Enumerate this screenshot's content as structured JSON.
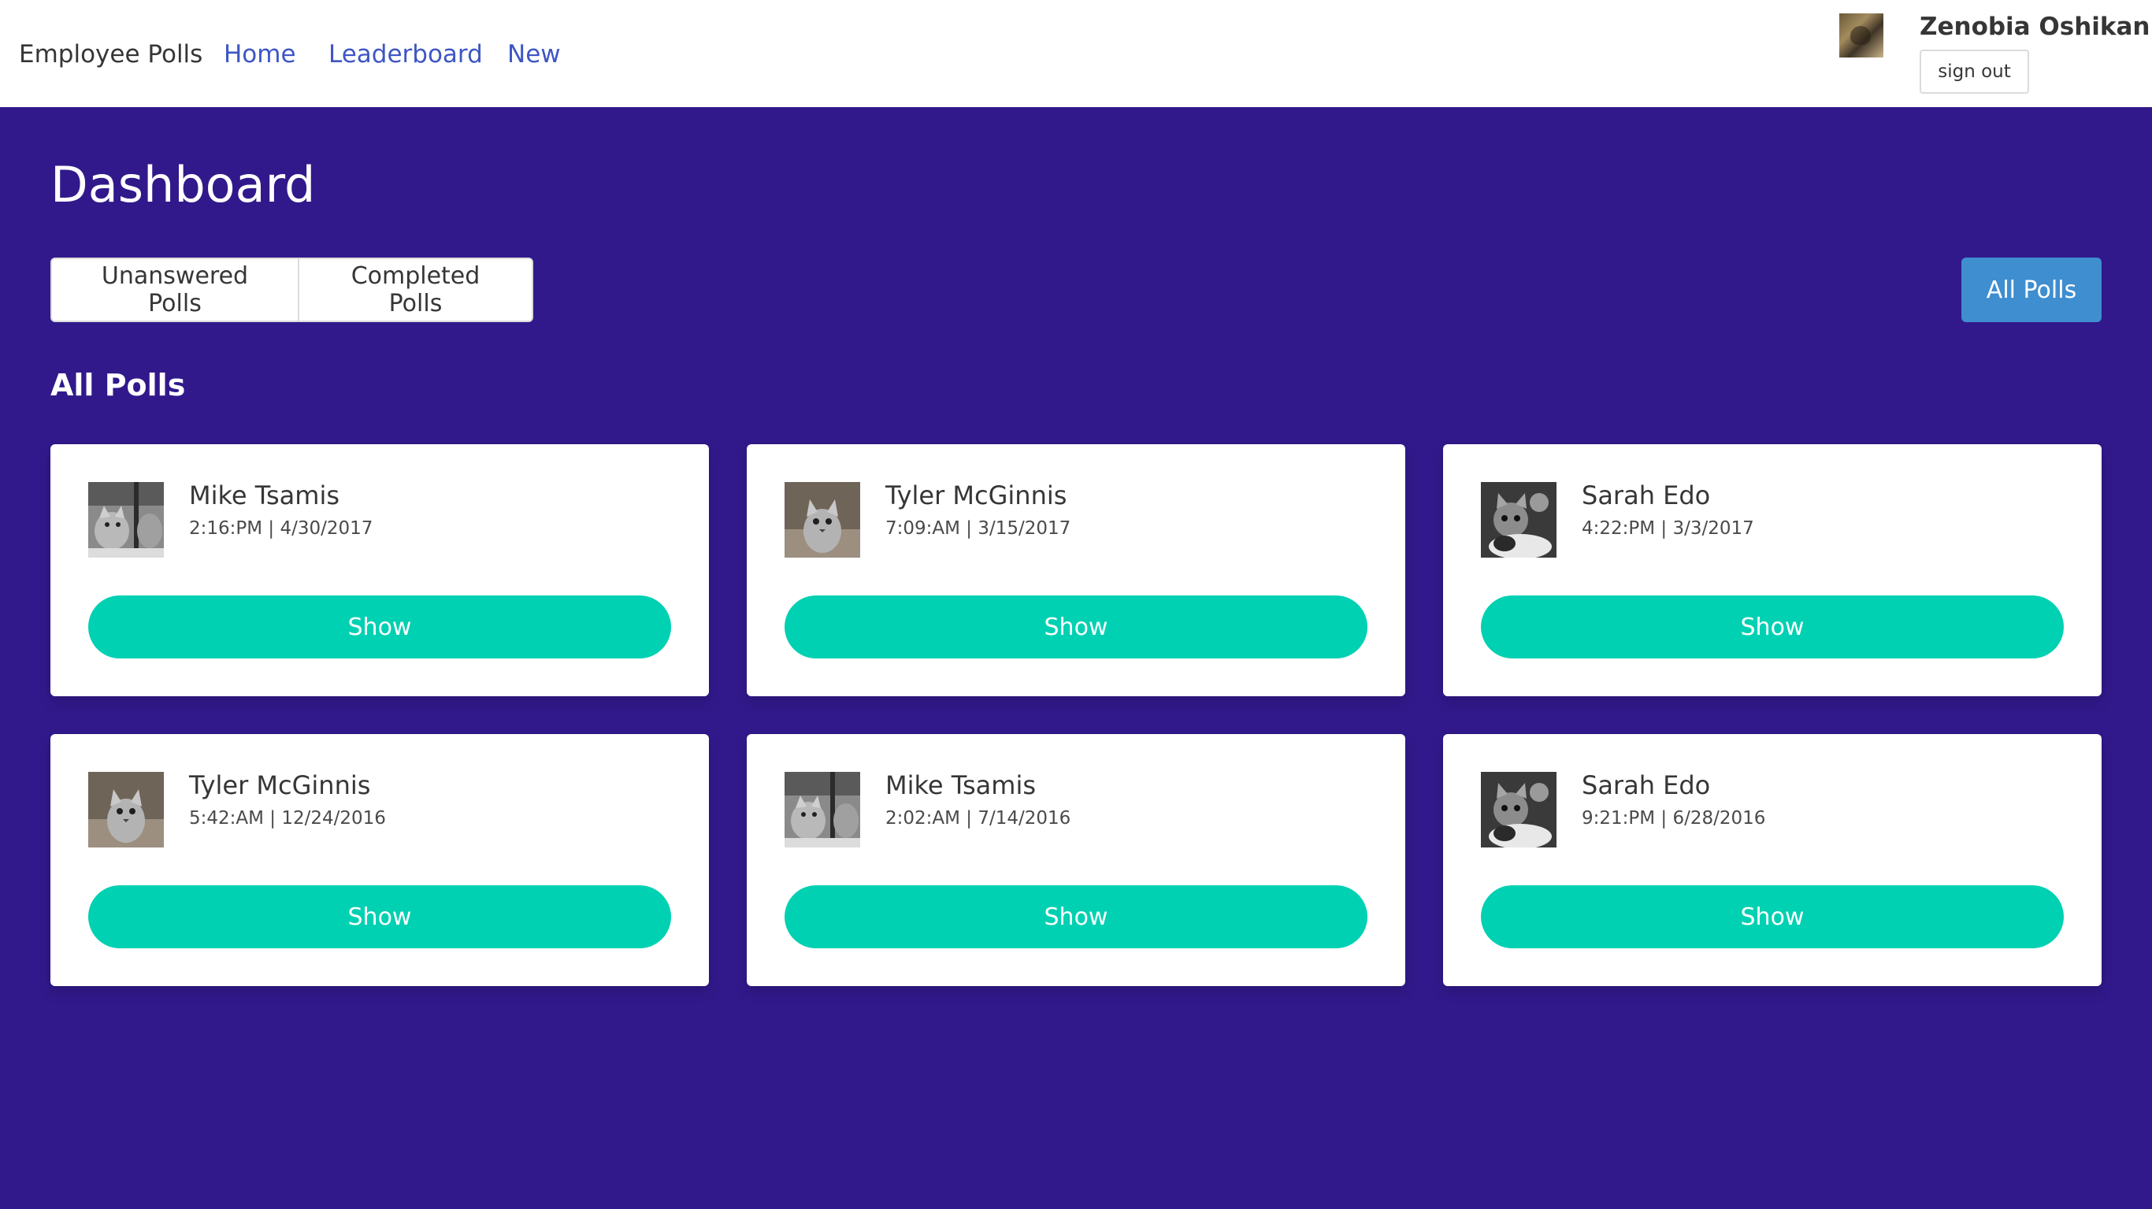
{
  "navbar": {
    "brand": "Employee Polls",
    "links": [
      "Home",
      "Leaderboard",
      "New"
    ],
    "user": {
      "name": "Zenobia Oshikanlu",
      "avatar_icon": "user-avatar-photo",
      "signout_label": "sign out"
    }
  },
  "main": {
    "title": "Dashboard",
    "filters": [
      "Unanswered Polls",
      "Completed Polls"
    ],
    "all_polls_button": "All Polls",
    "section_title": "All Polls",
    "show_label": "Show",
    "polls": [
      {
        "author": "Mike Tsamis",
        "timestamp": "2:16:PM | 4/30/2017",
        "avatar_icon": "kitten-photo"
      },
      {
        "author": "Tyler McGinnis",
        "timestamp": "7:09:AM | 3/15/2017",
        "avatar_icon": "kitten-photo"
      },
      {
        "author": "Sarah Edo",
        "timestamp": "4:22:PM | 3/3/2017",
        "avatar_icon": "kitten-photo"
      },
      {
        "author": "Tyler McGinnis",
        "timestamp": "5:42:AM | 12/24/2016",
        "avatar_icon": "kitten-photo"
      },
      {
        "author": "Mike Tsamis",
        "timestamp": "2:02:AM | 7/14/2016",
        "avatar_icon": "kitten-photo"
      },
      {
        "author": "Sarah Edo",
        "timestamp": "9:21:PM | 6/28/2016",
        "avatar_icon": "kitten-photo"
      }
    ]
  },
  "colors": {
    "background": "#31198b",
    "link": "#3e56c4",
    "primary_button": "#3e8ed0",
    "show_button": "#00d1b2",
    "card": "#ffffff"
  }
}
